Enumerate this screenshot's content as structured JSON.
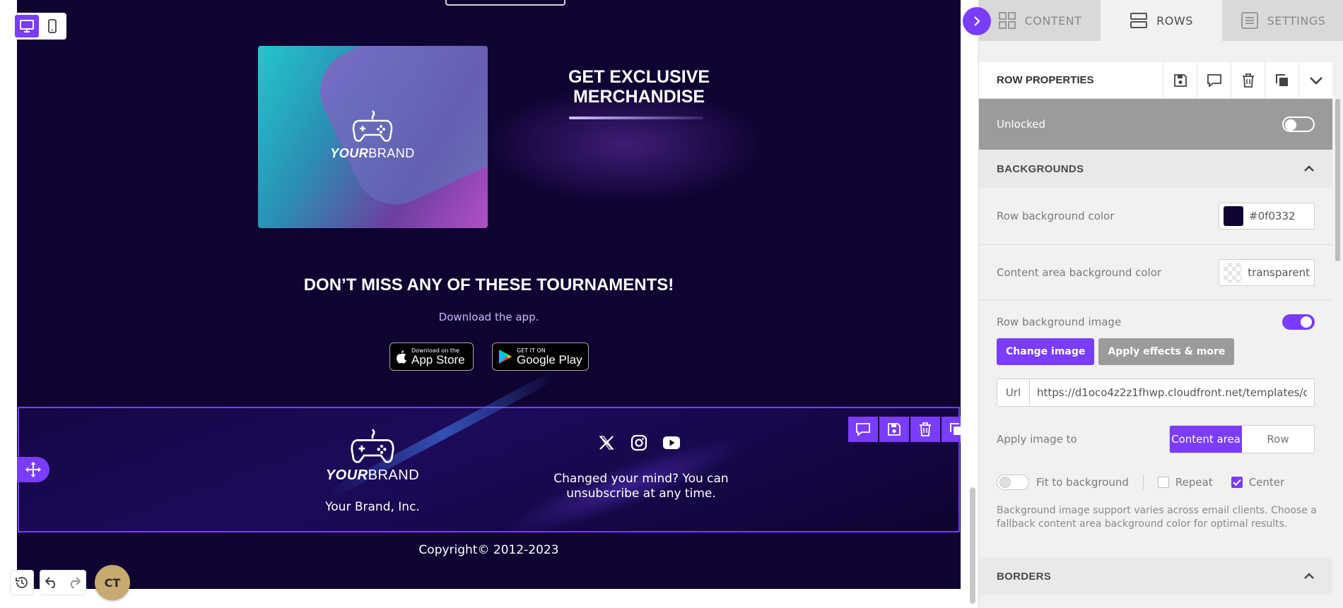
{
  "colors": {
    "accent": "#7a3cff",
    "canvas_bg": "#0f0332",
    "panel_bg": "#f1f1f1",
    "muted_bar": "#9b9b9b"
  },
  "email": {
    "merch_title": "GET EXCLUSIVE MERCHANDISE",
    "brand_wordmark_bold": "YOUR",
    "brand_wordmark_rest": "BRAND",
    "tournaments_title": "DON’T MISS ANY OF THESE TOURNAMENTS!",
    "tournaments_sub": "Download the app.",
    "app_store": {
      "small": "Download on the",
      "big": "App Store"
    },
    "google_play": {
      "small": "GET IT ON",
      "big": "Google Play"
    },
    "footer": {
      "company": "Your Brand, Inc.",
      "unsubscribe": "Changed your mind? You can unsubscribe at any time.",
      "social_icons": [
        "x-icon",
        "instagram-icon",
        "youtube-icon"
      ]
    },
    "copyright": "Copyright© 2012-2023"
  },
  "toolbar": {
    "view_modes": [
      "desktop",
      "mobile"
    ],
    "active_view": "desktop",
    "avatar_initials": "CT"
  },
  "panel": {
    "tabs": [
      {
        "label": "CONTENT",
        "icon": "grid-icon"
      },
      {
        "label": "ROWS",
        "icon": "rows-icon"
      },
      {
        "label": "SETTINGS",
        "icon": "settings-icon"
      }
    ],
    "active_tab": "ROWS",
    "header_title": "ROW PROPERTIES",
    "lock_label": "Unlocked",
    "backgrounds": {
      "title": "BACKGROUNDS",
      "row_bg_label": "Row background color",
      "row_bg_value": "#0f0332",
      "content_bg_label": "Content area background color",
      "content_bg_value": "transparent",
      "row_bg_image_label": "Row background image",
      "change_image": "Change image",
      "apply_effects": "Apply effects & more",
      "url_label": "Url",
      "url_value": "https://d1oco4z2z1fhwp.cloudfront.net/templates/default/",
      "apply_to_label": "Apply image to",
      "apply_to_options": [
        "Content area",
        "Row"
      ],
      "apply_to_selected": "Content area",
      "fit_label": "Fit to background",
      "repeat_label": "Repeat",
      "center_label": "Center",
      "hint": "Background image support varies across email clients. Choose a fallback content area background color for optimal results."
    },
    "borders_title": "BORDERS"
  }
}
